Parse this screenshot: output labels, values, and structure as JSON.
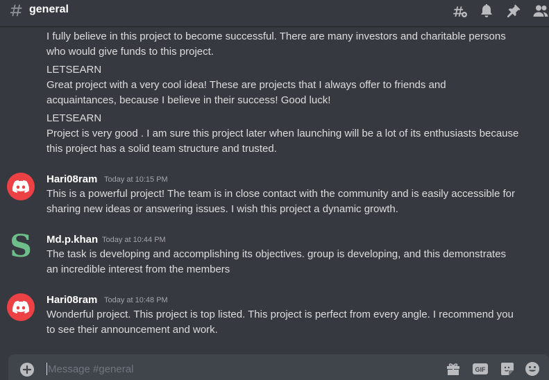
{
  "header": {
    "channel_name": "general",
    "icons": [
      "threads-icon",
      "bell-icon",
      "pin-icon",
      "members-icon"
    ]
  },
  "messages": [
    {
      "continued": true,
      "lines": [
        "I fully believe in this project to become successful. There are many investors and charitable persons",
        "who would give funds to this project.",
        "LETSEARN",
        "Great project with a very cool idea! These are projects that I always offer to friends and",
        "acquaintances, because I believe in their success! Good luck!",
        "LETSEARN",
        "Project is very good . I am sure this project later when launching will be a lot of its enthusiasts because",
        "this project has a solid team structure and trusted."
      ]
    },
    {
      "author": "Hari08ram",
      "timestamp": "Today at 10:15 PM",
      "avatar": "discord-logo-icon",
      "avatar_color": "#ed4245",
      "lines": [
        "This is a powerful project! The team is in close contact with the community and is easily accessible for",
        "sharing new ideas or answering issues. I wish this project a dynamic growth."
      ]
    },
    {
      "author": "Md.p.khan",
      "timestamp": "Today at 10:44 PM",
      "avatar_letter": "S",
      "avatar_color": "#6dbe8a",
      "lines": [
        "The task is developing and accomplishing its objectives. group is developing, and this demonstrates",
        "an incredible interest from the members"
      ]
    },
    {
      "author": "Hari08ram",
      "timestamp": "Today at 10:48 PM",
      "avatar": "discord-logo-icon",
      "avatar_color": "#ed4245",
      "lines": [
        "Wonderful project. This project is top listed. This project is perfect from every angle. I recommend you",
        "to see their announcement and work."
      ]
    }
  ],
  "composer": {
    "placeholder": "Message #general",
    "icons": [
      "gift-icon",
      "gif-icon",
      "sticker-icon",
      "emoji-icon"
    ]
  }
}
